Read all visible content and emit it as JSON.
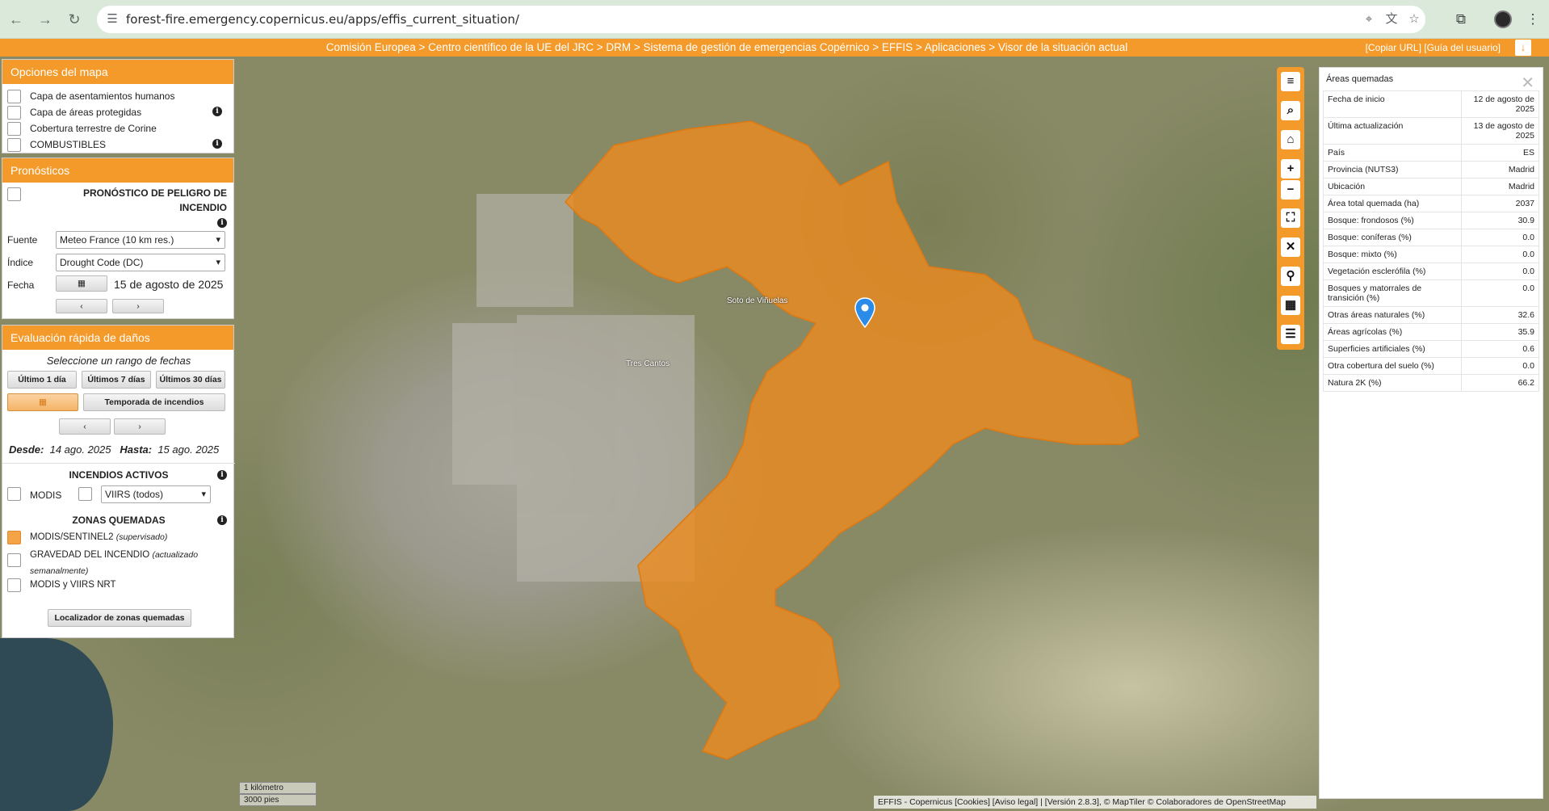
{
  "browser": {
    "url": "forest-fire.emergency.copernicus.eu/apps/effis_current_situation/"
  },
  "crumbs": {
    "path": "Comisión Europea > Centro científico de la UE del JRC > DRM > Sistema de gestión de emergencias Copérnico > EFFIS > Aplicaciones > Visor de la situación actual",
    "right": "[Copiar URL] [Guía del usuario]"
  },
  "map_options": {
    "title": "Opciones del mapa",
    "items": [
      "Capa de asentamientos humanos",
      "Capa de áreas protegidas",
      "Cobertura terrestre de Corine",
      "COMBUSTIBLES"
    ]
  },
  "forecasts": {
    "title": "Pronósticos",
    "danger_label": "PRONÓSTICO DE PELIGRO DE INCENDIO",
    "source_label": "Fuente",
    "source_value": "Meteo France (10 km res.)",
    "index_label": "Índice",
    "index_value": "Drought Code (DC)",
    "date_label": "Fecha",
    "date_value": "15 de agosto de 2025",
    "prev": "‹",
    "next": "›"
  },
  "damage": {
    "title": "Evaluación rápida de daños",
    "range_prompt": "Seleccione un rango de fechas",
    "btn_1d": "Último 1 día",
    "btn_7d": "Últimos 7 días",
    "btn_30d": "Últimos 30 días",
    "btn_season": "Temporada de incendios",
    "prev": "‹",
    "next": "›",
    "from_label": "Desde:",
    "from_value": "14 ago. 2025",
    "to_label": "Hasta:",
    "to_value": "15 ago. 2025",
    "active_title": "INCENDIOS ACTIVOS",
    "modis": "MODIS",
    "viirs": "VIIRS (todos)",
    "burned_title": "ZONAS QUEMADAS",
    "burned_1": "MODIS/SENTINEL2",
    "burned_1_note": "(supervisado)",
    "burned_2": "GRAVEDAD DEL INCENDIO",
    "burned_2_note": "(actualizado semanalmente)",
    "burned_3": "MODIS y VIIRS NRT",
    "locator_btn": "Localizador de zonas quemadas"
  },
  "burned_areas": {
    "title": "Áreas quemadas",
    "rows": [
      {
        "label": "Fecha de inicio",
        "value": "12 de agosto de 2025"
      },
      {
        "label": "Última actualización",
        "value": "13 de agosto de 2025"
      },
      {
        "label": "País",
        "value": "ES"
      },
      {
        "label": "Provincia (NUTS3)",
        "value": "Madrid"
      },
      {
        "label": "Ubicación",
        "value": "Madrid"
      },
      {
        "label": "Área total quemada (ha)",
        "value": "2037"
      },
      {
        "label": "Bosque: frondosos (%)",
        "value": "30.9"
      },
      {
        "label": "Bosque: coníferas (%)",
        "value": "0.0"
      },
      {
        "label": "Bosque: mixto (%)",
        "value": "0.0"
      },
      {
        "label": "Vegetación esclerófila (%)",
        "value": "0.0"
      },
      {
        "label": "Bosques y matorrales de transición (%)",
        "value": "0.0"
      },
      {
        "label": "Otras áreas naturales (%)",
        "value": "32.6"
      },
      {
        "label": "Áreas agrícolas (%)",
        "value": "35.9"
      },
      {
        "label": "Superficies artificiales (%)",
        "value": "0.6"
      },
      {
        "label": "Otra cobertura del suelo (%)",
        "value": "0.0"
      },
      {
        "label": "Natura 2K (%)",
        "value": "66.2"
      }
    ]
  },
  "map": {
    "label_1": "Tres Cantos",
    "label_2": "Soto de Viñuelas",
    "scale_1": "1 kilómetro",
    "scale_2": "3000 pies",
    "attribution": "EFFIS - Copernicus  [Cookies]  [Aviso legal] | [Versión 2.8.3], © MapTiler  © Colaboradores de OpenStreetMap"
  },
  "colors": {
    "accent": "#f39a2a",
    "burn_fill": "#f08a1c"
  },
  "icons": [
    "back-icon",
    "forward-icon",
    "reload-icon",
    "site-info-icon",
    "location-icon",
    "translate-icon",
    "star-icon",
    "extensions-icon",
    "menu-icon",
    "search-icon",
    "home-icon",
    "zoom-in-icon",
    "zoom-out-icon",
    "fullscreen-icon",
    "close-icon",
    "marker-icon",
    "grid-icon",
    "list-icon",
    "calendar-icon",
    "info-icon"
  ]
}
